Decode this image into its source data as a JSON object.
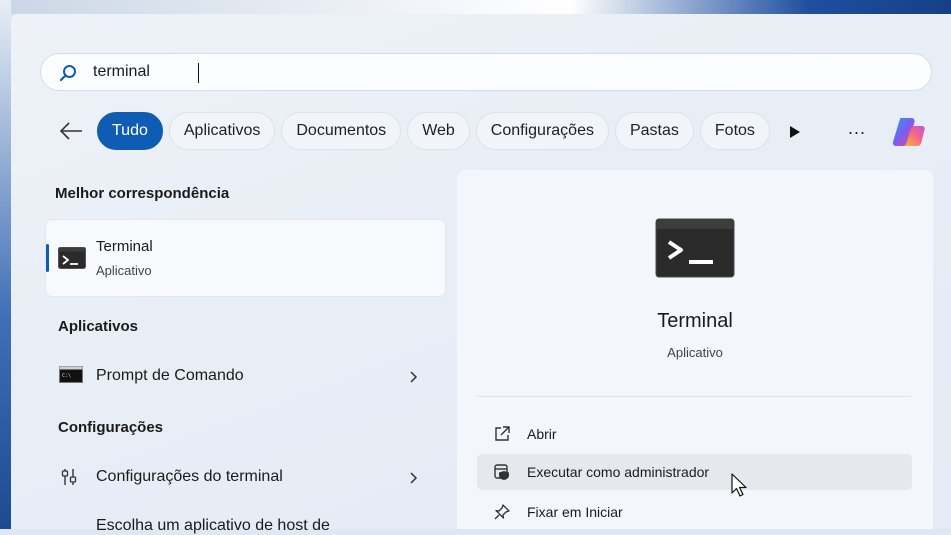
{
  "search": {
    "value": "terminal"
  },
  "filters": [
    "Tudo",
    "Aplicativos",
    "Documentos",
    "Web",
    "Configurações",
    "Pastas",
    "Fotos"
  ],
  "more": "...",
  "sections": {
    "best_match": "Melhor correspondência",
    "apps": "Aplicativos",
    "settings": "Configurações"
  },
  "best_match": {
    "title": "Terminal",
    "subtitle": "Aplicativo"
  },
  "apps": [
    {
      "label": "Prompt de Comando"
    }
  ],
  "settings": [
    {
      "label": "Configurações do terminal"
    }
  ],
  "cut_off_item": "Escolha um aplicativo de host de",
  "detail": {
    "title": "Terminal",
    "subtitle": "Aplicativo",
    "actions": [
      {
        "label": "Abrir",
        "icon": "open-external-icon"
      },
      {
        "label": "Executar como administrador",
        "icon": "admin-shield-icon"
      },
      {
        "label": "Fixar em Iniciar",
        "icon": "pin-icon"
      }
    ]
  },
  "colors": {
    "accent": "#0f5cb4"
  }
}
